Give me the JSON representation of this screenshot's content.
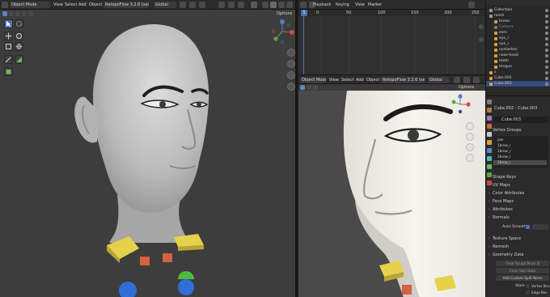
{
  "viewport_left": {
    "header": {
      "mode": "Object Mode",
      "menus": [
        "View",
        "Select",
        "Add",
        "Object"
      ],
      "addon": "RetopoFlow 3.2.6 (self)",
      "transform": "Global"
    },
    "options_label": "Options"
  },
  "timeline": {
    "menus": [
      "Playback",
      "Keying",
      "View",
      "Marker"
    ],
    "frame_ticks": [
      "0",
      "50",
      "100",
      "150",
      "200",
      "250"
    ],
    "current_frame": "1"
  },
  "viewport_right": {
    "header": {
      "mode": "Object Mode",
      "menus": [
        "View",
        "Select",
        "Add",
        "Object"
      ],
      "addon": "RetopoFlow 3.2.6 (self)",
      "transform": "Global"
    },
    "options_label": "Options"
  },
  "outliner": {
    "items": [
      {
        "label": "Collection",
        "color": "#9a9a9a"
      },
      {
        "label": "mesh",
        "color": "#9a9a9a"
      },
      {
        "label": "brows",
        "color": "#e09c3c"
      },
      {
        "label": "Camera",
        "color": "#7a7a7a"
      },
      {
        "label": "ears",
        "color": "#e09c3c"
      },
      {
        "label": "eye_l",
        "color": "#e09c3c"
      },
      {
        "label": "eye_r",
        "color": "#e09c3c"
      },
      {
        "label": "eyelashes",
        "color": "#e09c3c"
      },
      {
        "label": "nose-head",
        "color": "#e09c3c"
      },
      {
        "label": "teeth",
        "color": "#e09c3c"
      },
      {
        "label": "tongue",
        "color": "#e09c3c"
      },
      {
        "label": "s",
        "color": "#e09c3c"
      },
      {
        "label": "Cube.002",
        "color": "#e09c3c"
      },
      {
        "label": "Cube.003",
        "color": "#e09c3c"
      }
    ]
  },
  "properties": {
    "breadcrumb": [
      "Cube.002",
      "Cube.003"
    ],
    "object_name": "Cube.003",
    "vertex_groups_title": "Vertex Groups",
    "vertex_groups": [
      "jaw",
      "1brow_l",
      "1brow_r",
      "2brow_l",
      "2brow_r"
    ],
    "sections": [
      "Shape Keys",
      "UV Maps",
      "Color Attributes",
      "Face Maps",
      "Attributes",
      "Normals"
    ],
    "auto_smooth_label": "Auto Smooth",
    "sections2": [
      "Texture Space",
      "Remesh",
      "Geometry Data"
    ],
    "geometry_buttons": [
      "Clear Sculpt Mask D",
      "Clear Skin Data",
      "Add Custom Split Norm"
    ],
    "store_label": "Store",
    "store_options": [
      "Vertex Bev",
      "Edge Bev"
    ]
  }
}
